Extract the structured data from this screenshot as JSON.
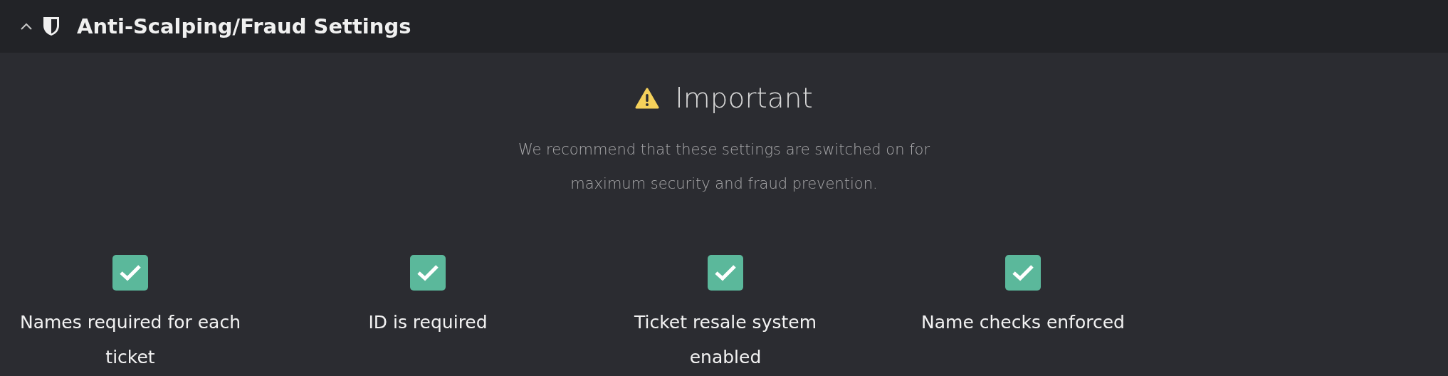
{
  "section": {
    "title": "Anti-Scalping/Fraud Settings",
    "expanded": true
  },
  "notice": {
    "title": "Important",
    "text": "We recommend that these settings are switched on for maximum security and fraud prevention."
  },
  "settings": [
    {
      "label": "Names required for each ticket",
      "checked": true
    },
    {
      "label": "ID is required",
      "checked": true
    },
    {
      "label": "Ticket resale system enabled",
      "checked": true
    },
    {
      "label": "Name checks enforced",
      "checked": true
    }
  ]
}
